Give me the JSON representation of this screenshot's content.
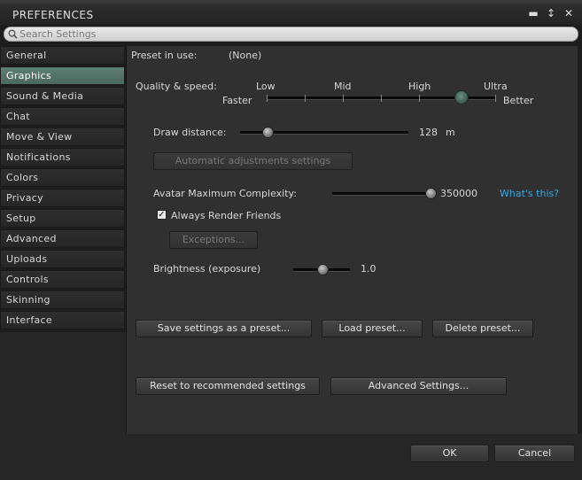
{
  "window": {
    "title": "PREFERENCES"
  },
  "search": {
    "placeholder": "Search Settings"
  },
  "sidebar": {
    "items": [
      {
        "label": "General"
      },
      {
        "label": "Graphics"
      },
      {
        "label": "Sound & Media"
      },
      {
        "label": "Chat"
      },
      {
        "label": "Move & View"
      },
      {
        "label": "Notifications"
      },
      {
        "label": "Colors"
      },
      {
        "label": "Privacy"
      },
      {
        "label": "Setup"
      },
      {
        "label": "Advanced"
      },
      {
        "label": "Uploads"
      },
      {
        "label": "Controls"
      },
      {
        "label": "Skinning"
      },
      {
        "label": "Interface"
      }
    ],
    "active": "Graphics"
  },
  "graphics": {
    "preset_label": "Preset in use:",
    "preset_value": "(None)",
    "quality_label": "Quality & speed:",
    "quality_levels": [
      "Low",
      "Mid",
      "High",
      "Ultra"
    ],
    "faster": "Faster",
    "better": "Better",
    "quality_value_fraction": 0.85,
    "draw_distance_label": "Draw distance:",
    "draw_distance_value": "128",
    "draw_distance_unit": "m",
    "draw_distance_fraction": 0.02,
    "auto_adjust_button": "Automatic adjustments settings",
    "avatar_complexity_label": "Avatar Maximum Complexity:",
    "avatar_complexity_value": "350000",
    "avatar_complexity_fraction": 1.0,
    "whats_this": "What's this?",
    "always_render_friends": "Always Render Friends",
    "always_render_checked": true,
    "exceptions_button": "Exceptions...",
    "brightness_label": "Brightness (exposure)",
    "brightness_value": "1.0",
    "brightness_fraction": 0.5,
    "save_preset_button": "Save settings as a preset...",
    "load_preset_button": "Load preset...",
    "delete_preset_button": "Delete preset...",
    "reset_button": "Reset to recommended settings",
    "advanced_button": "Advanced Settings..."
  },
  "footer": {
    "ok": "OK",
    "cancel": "Cancel"
  },
  "icons": {
    "minimize": "minimize-icon",
    "pin": "pin-icon",
    "close": "close-icon",
    "search": "search-icon"
  },
  "colors": {
    "accent": "#4f6f64",
    "link": "#3aa8e0"
  }
}
